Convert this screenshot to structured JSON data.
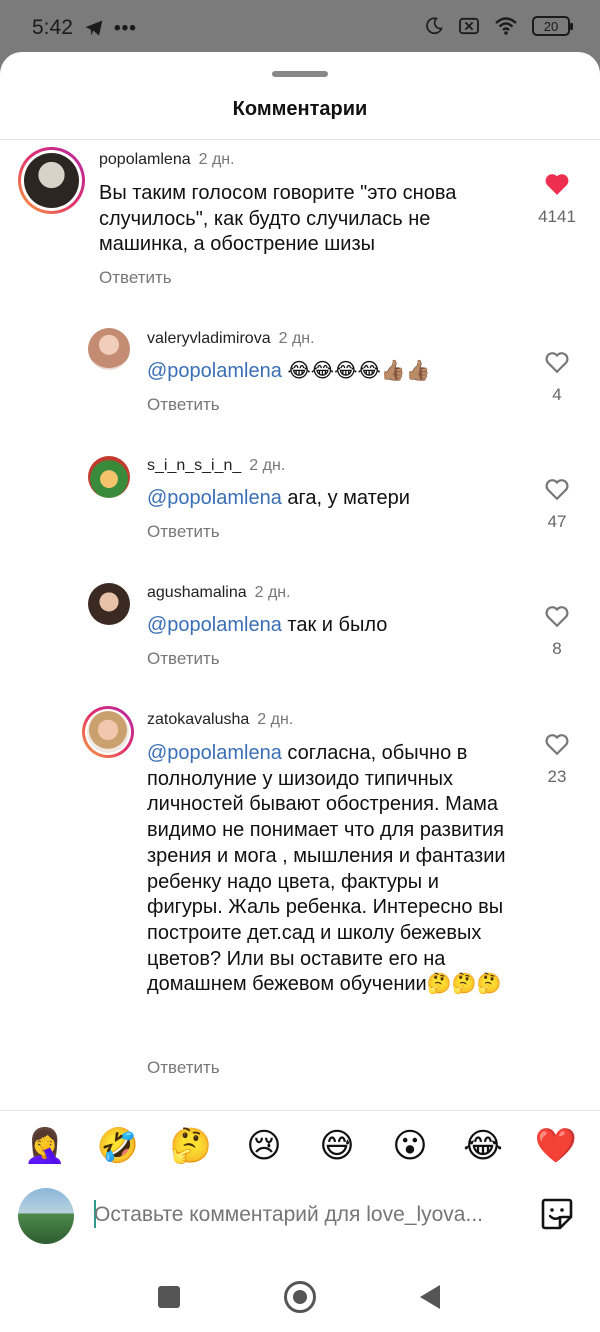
{
  "status_bar": {
    "time": "5:42",
    "left_icons": [
      "telegram-icon",
      "more-dots-icon"
    ],
    "right_icons": [
      "moon-icon",
      "x-box-icon",
      "wifi-icon"
    ],
    "battery": "20"
  },
  "sheet": {
    "title": "Комментарии"
  },
  "comments": [
    {
      "username": "popolamlena",
      "time": "2 дн.",
      "text": "Вы таким голосом говорите \"это снова случилось\", как будто случилась не машинка, а обострение шизы",
      "reply": "Ответить",
      "likes": "4141",
      "liked": true
    },
    {
      "username": "valeryvladimirova",
      "time": "2 дн.",
      "mention": "@popolamlena",
      "text": " 😂😂😂😂👍🏽👍🏽",
      "reply": "Ответить",
      "likes": "4",
      "liked": false
    },
    {
      "username": "s_i_n_s_i_n_",
      "time": "2 дн.",
      "mention": "@popolamlena",
      "text": " ага, у матери",
      "reply": "Ответить",
      "likes": "47",
      "liked": false
    },
    {
      "username": "agushamalina",
      "time": "2 дн.",
      "mention": "@popolamlena",
      "text": " так и было",
      "reply": "Ответить",
      "likes": "8",
      "liked": false
    },
    {
      "username": "zatokavalusha",
      "time": "2 дн.",
      "mention": "@popolamlena",
      "text": " согласна, обычно в полнолуние у шизоидо типичных личностей бывают обострения. Мама видимо не понимает что для развития зрения и мога , мышления и фантазии ребенку надо цвета, фактуры и фигуры. Жаль ребенка. Интересно вы построите дет.сад  и школу бежевых цветов? Или вы оставите его на домашнем бежевом обучении🤔🤔🤔",
      "reply": "Ответить",
      "likes": "23",
      "liked": false
    }
  ],
  "quick_emojis": [
    "🤦‍♀️",
    "🤣",
    "🤔",
    "😢",
    "😅",
    "😮",
    "😂",
    "❤️"
  ],
  "composer": {
    "placeholder": "Оставьте комментарий для love_lyova..."
  },
  "colors": {
    "like_red": "#ed2f4f",
    "mention_blue": "#3a6fb5",
    "status_bg": "#7b7b7b"
  },
  "nav_icons": [
    "recent-apps-icon",
    "home-icon",
    "back-icon"
  ]
}
